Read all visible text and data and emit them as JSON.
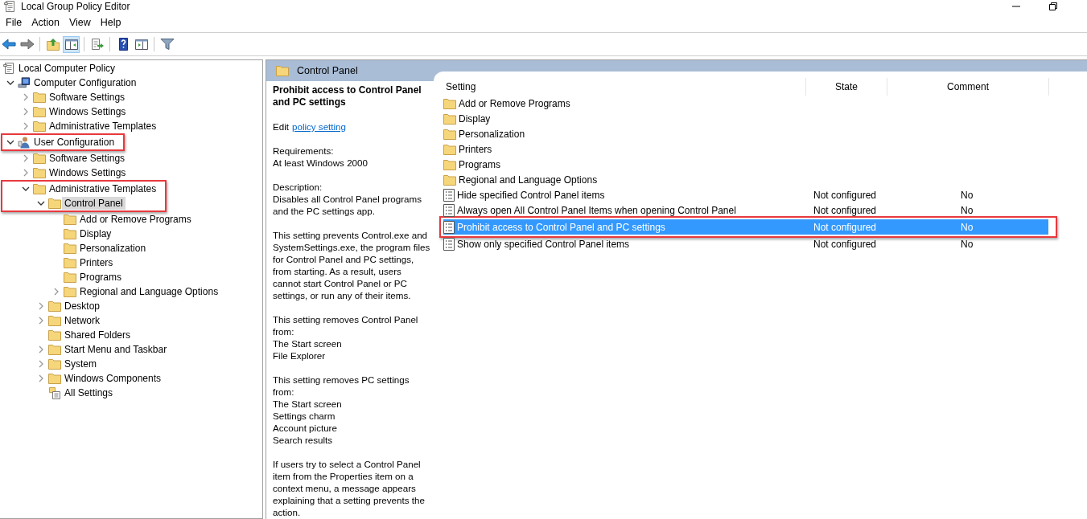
{
  "window": {
    "title": "Local Group Policy Editor"
  },
  "menu": [
    "File",
    "Action",
    "View",
    "Help"
  ],
  "toolbar": [
    {
      "kind": "back",
      "pressed": false
    },
    {
      "kind": "forward",
      "pressed": false
    },
    {
      "kind": "separator"
    },
    {
      "kind": "up",
      "pressed": false
    },
    {
      "kind": "tree",
      "pressed": true
    },
    {
      "kind": "separator"
    },
    {
      "kind": "export",
      "pressed": false
    },
    {
      "kind": "separator"
    },
    {
      "kind": "help",
      "pressed": false
    },
    {
      "kind": "pane",
      "pressed": false
    },
    {
      "kind": "separator"
    },
    {
      "kind": "filter",
      "pressed": false
    }
  ],
  "tree": [
    {
      "label": "Local Computer Policy",
      "kind": "policy",
      "selected": false,
      "annotated": false,
      "children": [
        {
          "label": "Computer Configuration",
          "kind": "computer",
          "expanded": true,
          "selected": false,
          "annotated": false,
          "children": [
            {
              "label": "Software Settings",
              "kind": "folder",
              "expanded": false,
              "selected": false,
              "annotated": false
            },
            {
              "label": "Windows Settings",
              "kind": "folder",
              "expanded": false,
              "selected": false,
              "annotated": false
            },
            {
              "label": "Administrative Templates",
              "kind": "folder",
              "expanded": false,
              "selected": false,
              "annotated": false
            }
          ]
        },
        {
          "label": "User Configuration",
          "kind": "user",
          "expanded": true,
          "selected": false,
          "annotated": true,
          "children": [
            {
              "label": "Software Settings",
              "kind": "folder",
              "expanded": false,
              "selected": false,
              "annotated": false
            },
            {
              "label": "Windows Settings",
              "kind": "folder",
              "expanded": false,
              "selected": false,
              "annotated": false
            },
            {
              "label": "Administrative Templates",
              "kind": "folder",
              "expanded": true,
              "selected": false,
              "annotated": true,
              "children": [
                {
                  "label": "Control Panel",
                  "kind": "folder",
                  "expanded": true,
                  "selected": true,
                  "annotated": true,
                  "children": [
                    {
                      "label": "Add or Remove Programs",
                      "kind": "folder",
                      "selected": false,
                      "annotated": false
                    },
                    {
                      "label": "Display",
                      "kind": "folder",
                      "selected": false,
                      "annotated": false
                    },
                    {
                      "label": "Personalization",
                      "kind": "folder",
                      "selected": false,
                      "annotated": false
                    },
                    {
                      "label": "Printers",
                      "kind": "folder",
                      "selected": false,
                      "annotated": false
                    },
                    {
                      "label": "Programs",
                      "kind": "folder",
                      "selected": false,
                      "annotated": false
                    },
                    {
                      "label": "Regional and Language Options",
                      "kind": "folder",
                      "expanded": false,
                      "selected": false,
                      "annotated": false
                    }
                  ]
                },
                {
                  "label": "Desktop",
                  "kind": "folder",
                  "expanded": false,
                  "selected": false,
                  "annotated": false
                },
                {
                  "label": "Network",
                  "kind": "folder",
                  "expanded": false,
                  "selected": false,
                  "annotated": false
                },
                {
                  "label": "Shared Folders",
                  "kind": "folder",
                  "selected": false,
                  "annotated": false
                },
                {
                  "label": "Start Menu and Taskbar",
                  "kind": "folder",
                  "expanded": false,
                  "selected": false,
                  "annotated": false
                },
                {
                  "label": "System",
                  "kind": "folder",
                  "expanded": false,
                  "selected": false,
                  "annotated": false
                },
                {
                  "label": "Windows Components",
                  "kind": "folder",
                  "expanded": false,
                  "selected": false,
                  "annotated": false
                },
                {
                  "label": "All Settings",
                  "kind": "settings",
                  "selected": false,
                  "annotated": false
                }
              ]
            }
          ]
        }
      ]
    }
  ],
  "details": {
    "header": "Control Panel",
    "title": "Prohibit access to Control Panel and PC settings",
    "edit_prefix": "Edit",
    "edit_link": "policy setting",
    "paragraphs": [
      "Requirements:\nAt least Windows 2000",
      "Description:\nDisables all Control Panel programs\nand the PC settings app.",
      "This setting prevents Control.exe and\nSystemSettings.exe, the program files\nfor Control Panel and PC settings,\nfrom starting. As a result, users\ncannot start Control Panel or PC\nsettings, or run any of their items.",
      "This setting removes Control Panel\nfrom:\nThe Start screen\nFile Explorer",
      "This setting removes PC settings\nfrom:\nThe Start screen\nSettings charm\nAccount picture\nSearch results",
      "If users try to select a Control Panel\nitem from the Properties item on a\ncontext menu, a message appears\nexplaining that a setting prevents the\naction."
    ]
  },
  "table": {
    "columns": [
      "Setting",
      "State",
      "Comment"
    ],
    "rows": [
      {
        "kind": "folder",
        "setting": "Add or Remove Programs",
        "selected": false,
        "annotated": false
      },
      {
        "kind": "folder",
        "setting": "Display",
        "selected": false,
        "annotated": false
      },
      {
        "kind": "folder",
        "setting": "Personalization",
        "selected": false,
        "annotated": false
      },
      {
        "kind": "folder",
        "setting": "Printers",
        "selected": false,
        "annotated": false
      },
      {
        "kind": "folder",
        "setting": "Programs",
        "selected": false,
        "annotated": false
      },
      {
        "kind": "folder",
        "setting": "Regional and Language Options",
        "selected": false,
        "annotated": false
      },
      {
        "kind": "policy",
        "setting": "Hide specified Control Panel items",
        "state": "Not configured",
        "comment": "No",
        "selected": false,
        "annotated": false
      },
      {
        "kind": "policy",
        "setting": "Always open All Control Panel Items when opening Control Panel",
        "state": "Not configured",
        "comment": "No",
        "selected": false,
        "annotated": false
      },
      {
        "kind": "policy",
        "setting": "Prohibit access to Control Panel and PC settings",
        "state": "Not configured",
        "comment": "No",
        "selected": true,
        "annotated": true
      },
      {
        "kind": "policy",
        "setting": "Show only specified Control Panel items",
        "state": "Not configured",
        "comment": "No",
        "selected": false,
        "annotated": false
      }
    ]
  }
}
